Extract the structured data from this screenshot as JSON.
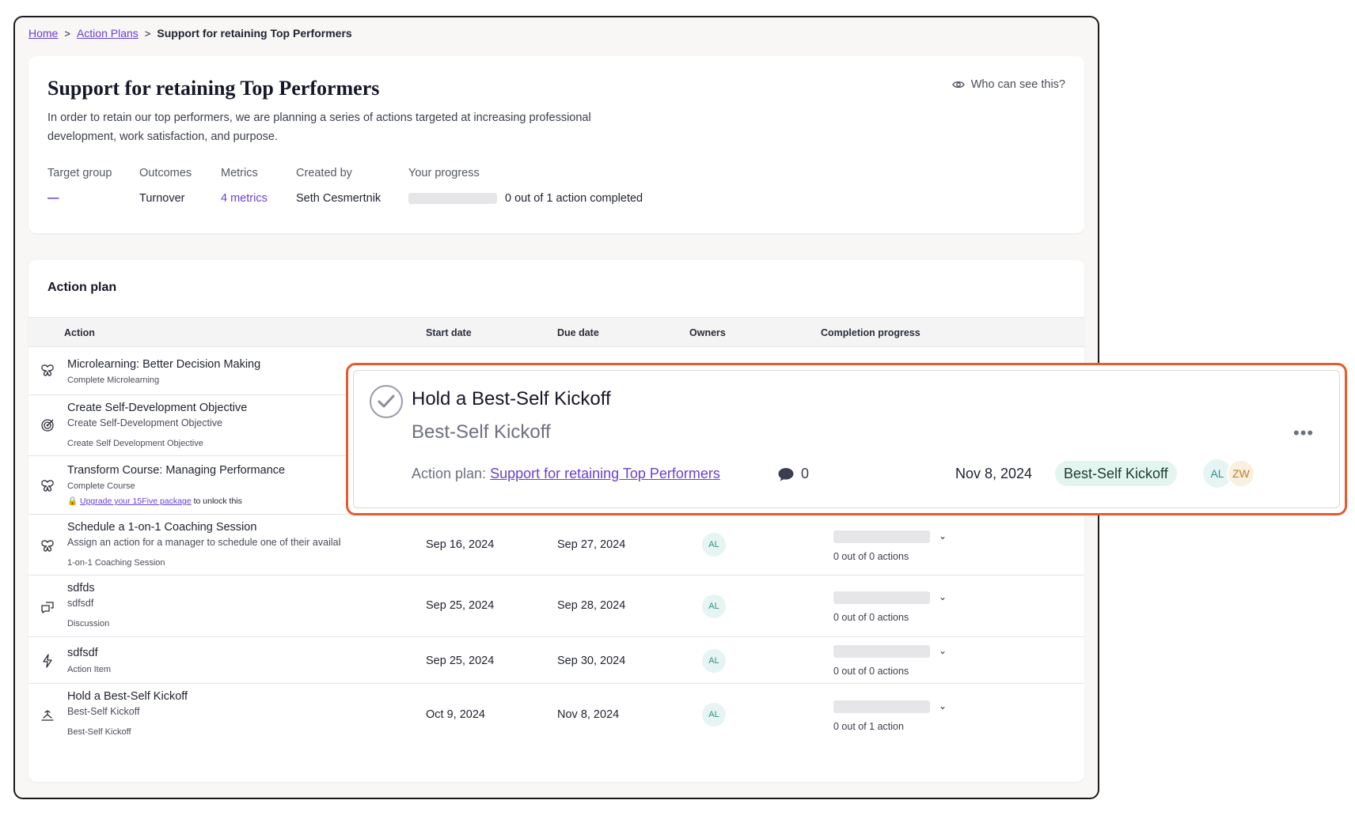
{
  "breadcrumb": {
    "home": "Home",
    "action_plans": "Action Plans",
    "current": "Support for retaining Top Performers",
    "separator": ">"
  },
  "plan": {
    "title": "Support for retaining Top Performers",
    "description": "In order to retain our top performers, we are planning a series of actions targeted at increasing professional development, work satisfaction, and purpose.",
    "who_can_see": "Who can see this?",
    "who_can_see_icon": "eye-icon",
    "meta": {
      "target_group_label": "Target group",
      "target_group_value": "—",
      "outcomes_label": "Outcomes",
      "outcomes_value": "Turnover",
      "metrics_label": "Metrics",
      "metrics_value": "4 metrics",
      "created_by_label": "Created by",
      "created_by_value": "Seth Cesmertnik",
      "progress_label": "Your progress",
      "progress_text": "0 out of 1 action completed",
      "progress_fraction": 0
    }
  },
  "action_plan": {
    "title": "Action plan",
    "columns": {
      "action": "Action",
      "start": "Start date",
      "due": "Due date",
      "owners": "Owners",
      "completion": "Completion progress"
    },
    "rows": [
      {
        "name": "Microlearning: Better Decision Making",
        "type": "Complete Microlearning",
        "icon": "butterfly-icon"
      },
      {
        "name": "Create Self-Development Objective",
        "subtitle": "Create Self-Development Objective",
        "type": "Create Self Development Objective",
        "icon": "target-icon"
      },
      {
        "name": "Transform Course: Managing Performance",
        "type": "Complete Course",
        "icon": "butterfly-icon",
        "lock_link": "Upgrade your 15Five package",
        "lock_suffix": "to unlock this"
      },
      {
        "name": "Schedule a 1-on-1 Coaching Session",
        "subtitle": "Assign an action for a manager to schedule one of their available",
        "type": "1-on-1 Coaching Session",
        "icon": "butterfly-icon",
        "start": "Sep 16, 2024",
        "due": "Sep 27, 2024",
        "owner": "AL",
        "progress_text": "0 out of 0 actions"
      },
      {
        "name": "sdfds",
        "subtitle": "sdfsdf",
        "type": "Discussion",
        "icon": "chat-bubbles-icon",
        "start": "Sep 25, 2024",
        "due": "Sep 28, 2024",
        "owner": "AL",
        "progress_text": "0 out of 0 actions"
      },
      {
        "name": "sdfsdf",
        "type": "Action Item",
        "icon": "lightning-icon",
        "start": "Sep 25, 2024",
        "due": "Sep 30, 2024",
        "owner": "AL",
        "progress_text": "0 out of 0 actions"
      },
      {
        "name": "Hold a Best-Self Kickoff",
        "subtitle": "Best-Self Kickoff",
        "type": "Best-Self Kickoff",
        "icon": "kickoff-icon",
        "start": "Oct 9, 2024",
        "due": "Nov 8, 2024",
        "owner": "AL",
        "progress_text": "0 out of 1 action"
      }
    ]
  },
  "popup": {
    "title": "Hold a Best-Self Kickoff",
    "subtitle": "Best-Self Kickoff",
    "plan_prefix": "Action plan:",
    "plan_link": "Support for retaining Top Performers",
    "comment_count": "0",
    "due_date": "Nov 8, 2024",
    "badge": "Best-Self Kickoff",
    "owners": [
      "AL",
      "ZW"
    ],
    "more": "•••"
  },
  "colors": {
    "accent": "#6b3fd4",
    "highlight_border": "#e85a2c",
    "badge_bg": "#e3f5ef",
    "avatar_bg": "#e6f5f3"
  }
}
